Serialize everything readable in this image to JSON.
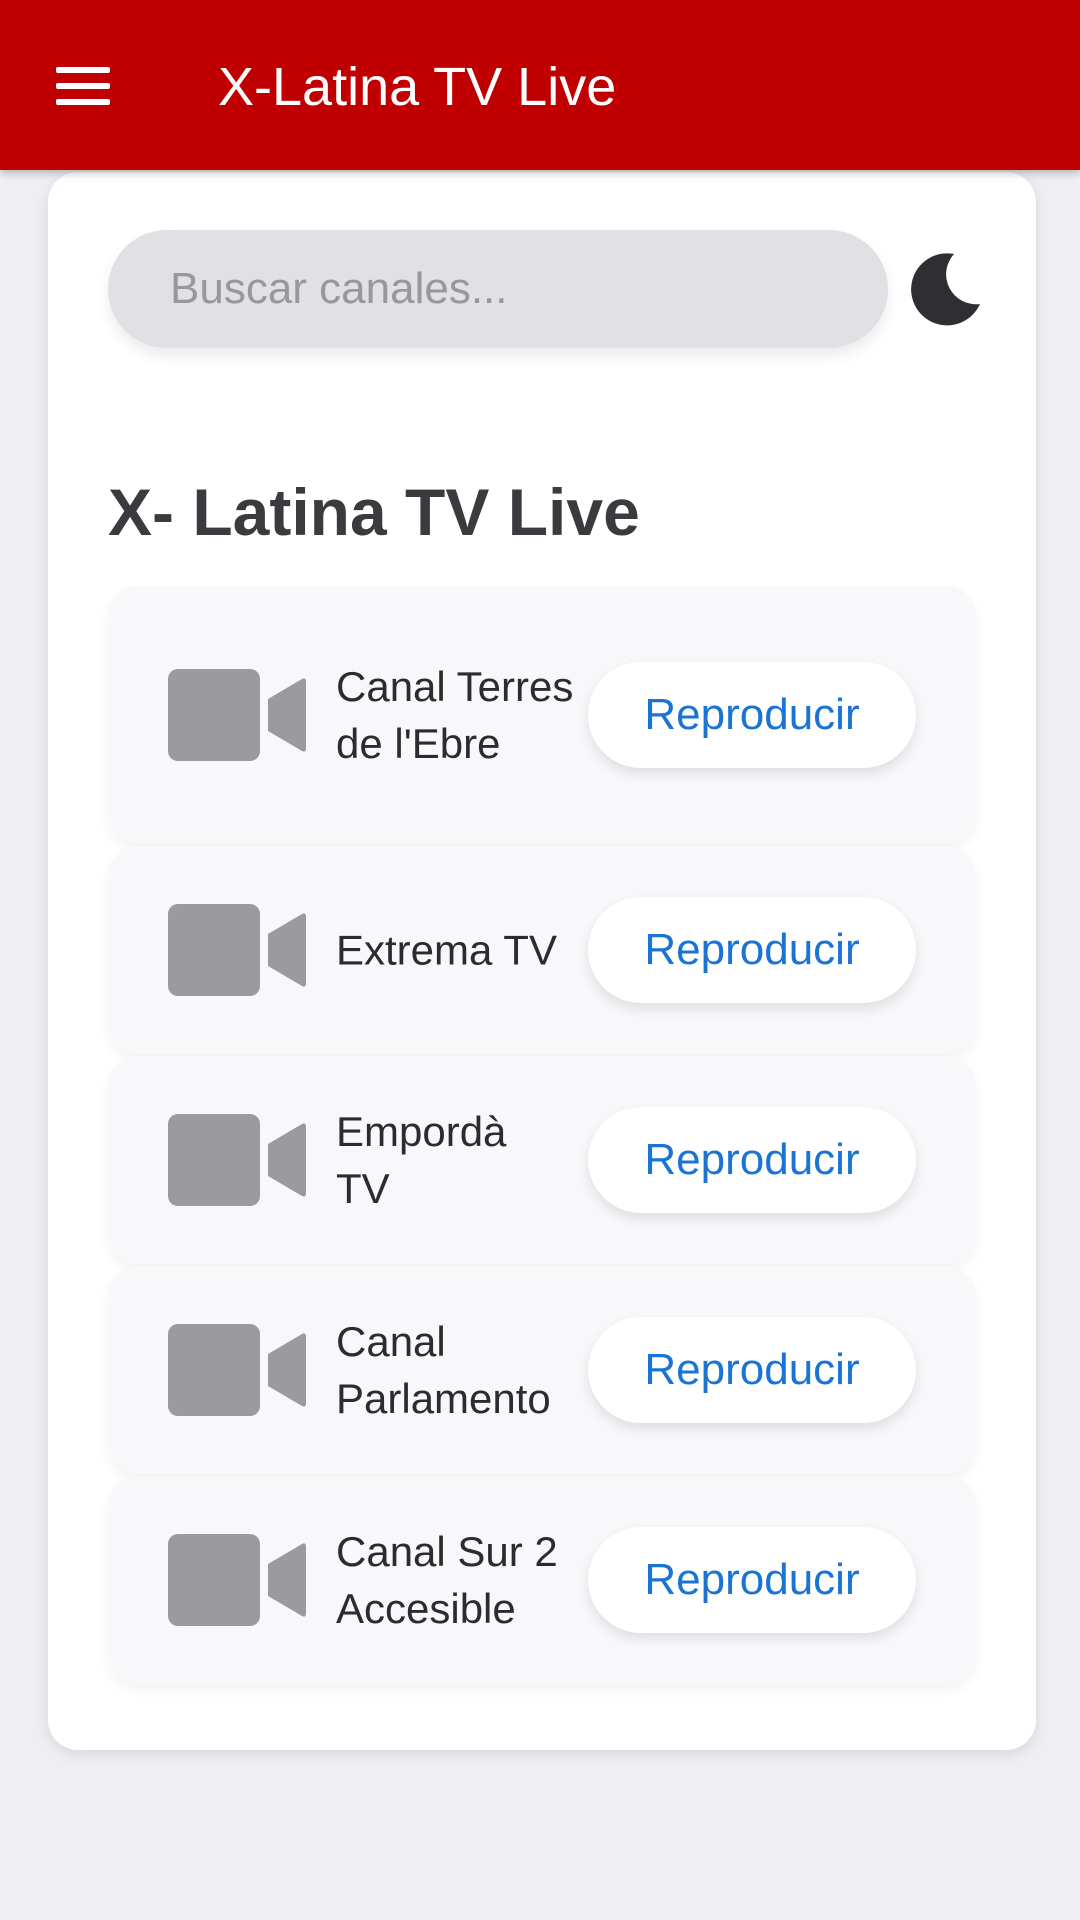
{
  "app_bar": {
    "title": "X-Latina TV Live",
    "background_color": "#c00000",
    "menu_icon": "hamburger-menu-icon"
  },
  "search": {
    "placeholder": "Buscar canales...",
    "value": ""
  },
  "theme_toggle": {
    "icon": "moon-icon"
  },
  "section": {
    "title": "X- Latina TV Live"
  },
  "channels": [
    {
      "name": "Canal Terres de l'Ebre",
      "action_label": "Reproducir",
      "icon": "video-camera-icon"
    },
    {
      "name": "Extrema TV",
      "action_label": "Reproducir",
      "icon": "video-camera-icon"
    },
    {
      "name": "Empordà TV",
      "action_label": "Reproducir",
      "icon": "video-camera-icon"
    },
    {
      "name": "Canal Parlamento",
      "action_label": "Reproducir",
      "icon": "video-camera-icon"
    },
    {
      "name": "Canal Sur 2 Accesible",
      "action_label": "Reproducir",
      "icon": "video-camera-icon"
    }
  ],
  "colors": {
    "accent": "#c00000",
    "link": "#1a74d4",
    "icon_gray": "#9b9a9f"
  }
}
